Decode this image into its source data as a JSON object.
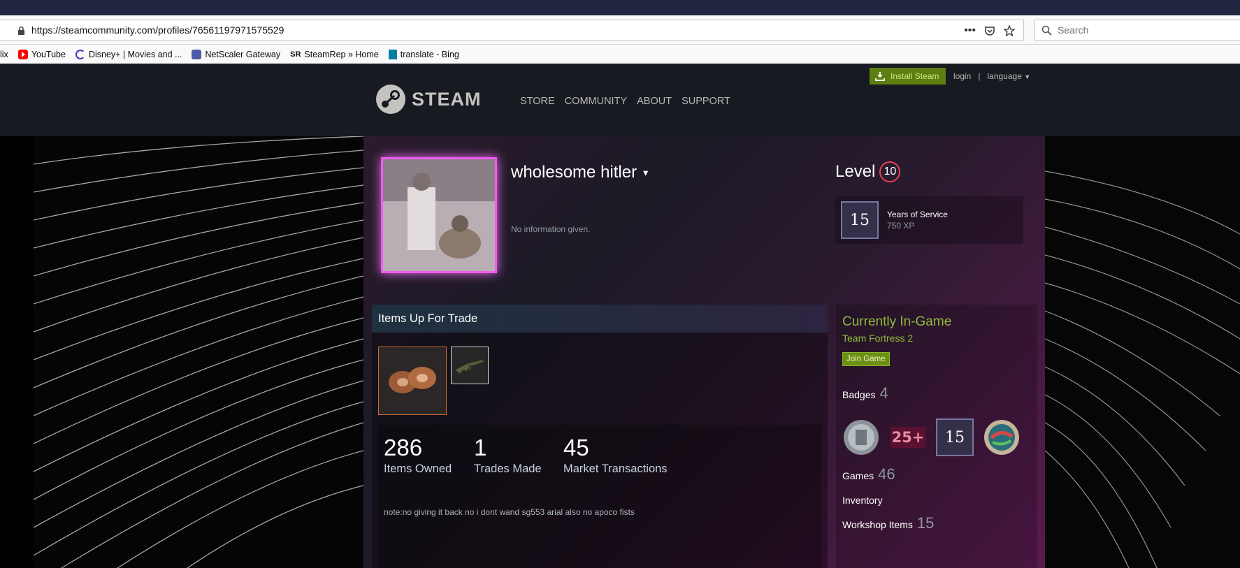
{
  "browser": {
    "url": "https://steamcommunity.com/profiles/76561197971575529",
    "search_placeholder": "Search",
    "bookmarks": [
      {
        "label": "lix",
        "icon": "netflix-icon"
      },
      {
        "label": "YouTube",
        "icon": "youtube-icon"
      },
      {
        "label": "Disney+ | Movies and ...",
        "icon": "disney-icon"
      },
      {
        "label": "NetScaler Gateway",
        "icon": "netscaler-icon"
      },
      {
        "label": "SteamRep » Home",
        "icon": "steamrep-icon",
        "prefix": "SR"
      },
      {
        "label": "translate - Bing",
        "icon": "bing-icon"
      }
    ]
  },
  "header": {
    "logo": "STEAM",
    "nav": [
      "STORE",
      "COMMUNITY",
      "ABOUT",
      "SUPPORT"
    ],
    "install": "Install Steam",
    "login": "login",
    "separator": "|",
    "language": "language"
  },
  "profile": {
    "name": "wholesome hitler",
    "summary": "No information given.",
    "level_label": "Level",
    "level": "10",
    "favorite_badge": {
      "number": "15",
      "title": "Years of Service",
      "xp": "750 XP"
    }
  },
  "trade": {
    "title": "Items Up For Trade",
    "stats": [
      {
        "value": "286",
        "label": "Items Owned"
      },
      {
        "value": "1",
        "label": "Trades Made"
      },
      {
        "value": "45",
        "label": "Market Transactions"
      }
    ],
    "note": "note:no giving it back no i dont wand sg553 arial also no apoco fists"
  },
  "sidebar": {
    "ingame_title": "Currently In-Game",
    "game": "Team Fortress 2",
    "join": "Join Game",
    "badges_label": "Badges",
    "badges_count": "4",
    "badge_25": "25+",
    "badge_15": "15",
    "games_label": "Games",
    "games_count": "46",
    "inventory_label": "Inventory",
    "workshop_label": "Workshop Items",
    "workshop_count": "15"
  },
  "colors": {
    "accent_green": "#5c7e10",
    "level_ring": "#e64054",
    "frame_glow": "#ee5cf0"
  }
}
